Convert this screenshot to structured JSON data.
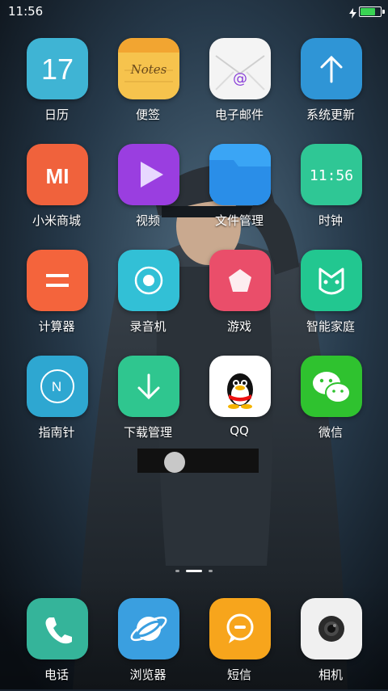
{
  "status_bar": {
    "time": "11:56",
    "battery_level": 0.7
  },
  "apps": [
    {
      "id": "calendar",
      "label": "日历",
      "date": "17"
    },
    {
      "id": "notes",
      "label": "便签",
      "script": "Notes"
    },
    {
      "id": "email",
      "label": "电子邮件",
      "glyph": "@"
    },
    {
      "id": "updater",
      "label": "系统更新"
    },
    {
      "id": "mi-store",
      "label": "小米商城",
      "glyph": "MI"
    },
    {
      "id": "video",
      "label": "视频"
    },
    {
      "id": "file-manager",
      "label": "文件管理"
    },
    {
      "id": "clock",
      "label": "时钟",
      "clock_text": "11:56"
    },
    {
      "id": "calculator",
      "label": "计算器"
    },
    {
      "id": "recorder",
      "label": "录音机"
    },
    {
      "id": "games",
      "label": "游戏"
    },
    {
      "id": "smart-home",
      "label": "智能家庭"
    },
    {
      "id": "compass",
      "label": "指南针",
      "glyph": "N"
    },
    {
      "id": "downloads",
      "label": "下载管理"
    },
    {
      "id": "qq",
      "label": "QQ"
    },
    {
      "id": "wechat",
      "label": "微信"
    }
  ],
  "dock": [
    {
      "id": "phone",
      "label": "电话"
    },
    {
      "id": "browser",
      "label": "浏览器"
    },
    {
      "id": "messages",
      "label": "短信"
    },
    {
      "id": "camera",
      "label": "相机"
    }
  ],
  "pager": {
    "pages": 3,
    "current": 2
  },
  "colors": {
    "calendar": "#3fb4d4",
    "notes": "#f6c34d",
    "email": "#f4f4f4",
    "updater": "#2f95d6",
    "mi-store": "#f0623c",
    "video": "#9a3ee0",
    "file-manager": "#2e97ee",
    "clock": "#2fc795",
    "calculator": "#f4643c",
    "recorder": "#32c0d6",
    "games": "#ea4e6a",
    "smart-home": "#22c790",
    "compass": "#2ea7d1",
    "downloads": "#2fc68f",
    "qq": "#ffffff",
    "wechat": "#2fc22f",
    "phone": "#35b49a",
    "browser": "#3a9fe0",
    "messages": "#f7a51c",
    "camera": "#f0f0f0"
  }
}
